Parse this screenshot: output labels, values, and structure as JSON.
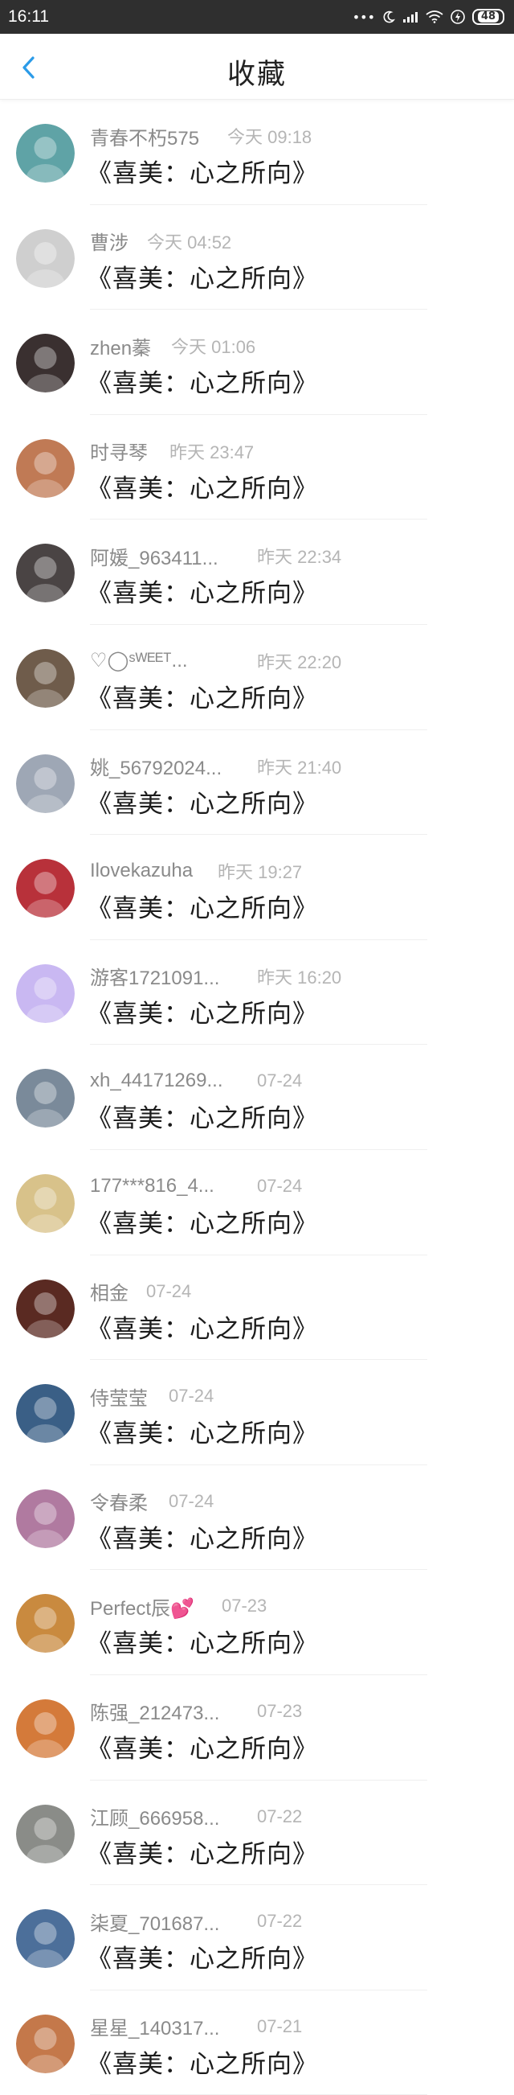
{
  "status_bar": {
    "time": "16:11",
    "dots": "•••",
    "battery": "48"
  },
  "header": {
    "title": "收藏",
    "back_icon": "chevron-left-icon",
    "accent_color": "#2b9be8"
  },
  "favorites": [
    {
      "user": "青春不朽575",
      "time": "今天 09:18",
      "title": "《喜美：心之所向》",
      "avatar_color": "#5fa3a6"
    },
    {
      "user": "曹涉",
      "time": "今天 04:52",
      "title": "《喜美：心之所向》",
      "avatar_color": "#cfcfcf"
    },
    {
      "user": "zhen蓁",
      "time": "今天 01:06",
      "title": "《喜美：心之所向》",
      "avatar_color": "#3a3030"
    },
    {
      "user": "时寻琴",
      "time": "昨天 23:47",
      "title": "《喜美：心之所向》",
      "avatar_color": "#c07a55"
    },
    {
      "user": "阿媛_963411...",
      "time": "昨天 22:34",
      "title": "《喜美：心之所向》",
      "avatar_color": "#4a4444"
    },
    {
      "user": "♡◯ˢᵂᴱᴱᵀ...",
      "time": "昨天 22:20",
      "title": "《喜美：心之所向》",
      "avatar_color": "#6f5c4b"
    },
    {
      "user": "姚_56792024...",
      "time": "昨天 21:40",
      "title": "《喜美：心之所向》",
      "avatar_color": "#9ea7b5"
    },
    {
      "user": "Ilovekazuha",
      "time": "昨天 19:27",
      "title": "《喜美：心之所向》",
      "avatar_color": "#b8313a"
    },
    {
      "user": "游客1721091...",
      "time": "昨天 16:20",
      "title": "《喜美：心之所向》",
      "avatar_color": "#c9b8f2"
    },
    {
      "user": "xh_44171269...",
      "time": "07-24",
      "title": "《喜美：心之所向》",
      "avatar_color": "#7a8a9a"
    },
    {
      "user": "177***816_4...",
      "time": "07-24",
      "title": "《喜美：心之所向》",
      "avatar_color": "#d8c28a"
    },
    {
      "user": "相金",
      "time": "07-24",
      "title": "《喜美：心之所向》",
      "avatar_color": "#5a2a22"
    },
    {
      "user": "侍莹莹",
      "time": "07-24",
      "title": "《喜美：心之所向》",
      "avatar_color": "#3a5f86"
    },
    {
      "user": "令春柔",
      "time": "07-24",
      "title": "《喜美：心之所向》",
      "avatar_color": "#b07aa0"
    },
    {
      "user": "Perfect辰💕",
      "time": "07-23",
      "title": "《喜美：心之所向》",
      "avatar_color": "#c98a3f"
    },
    {
      "user": "陈强_212473...",
      "time": "07-23",
      "title": "《喜美：心之所向》",
      "avatar_color": "#d47a3a"
    },
    {
      "user": "江顾_666958...",
      "time": "07-22",
      "title": "《喜美：心之所向》",
      "avatar_color": "#8a8c88"
    },
    {
      "user": "柒夏_701687...",
      "time": "07-22",
      "title": "《喜美：心之所向》",
      "avatar_color": "#4c6f9a"
    },
    {
      "user": "星星_140317...",
      "time": "07-21",
      "title": "《喜美：心之所向》",
      "avatar_color": "#c4784a"
    }
  ]
}
